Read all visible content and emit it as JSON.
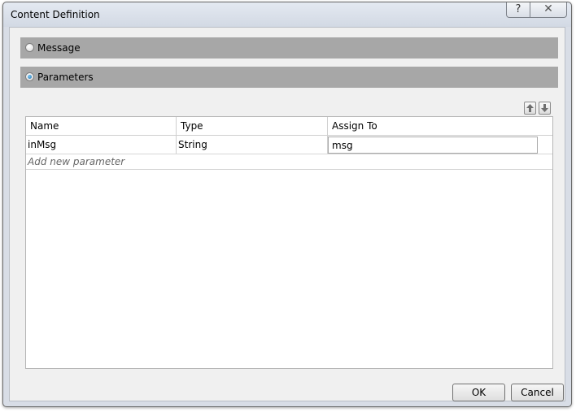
{
  "window": {
    "title": "Content Definition",
    "help_glyph": "?",
    "close_glyph": "✕"
  },
  "sections": {
    "message": {
      "label": "Message",
      "selected": false
    },
    "parameters": {
      "label": "Parameters",
      "selected": true
    }
  },
  "table": {
    "columns": [
      "Name",
      "Type",
      "Assign To"
    ],
    "rows": [
      {
        "name": "inMsg",
        "type": "String",
        "assign_to": "msg"
      }
    ],
    "add_new_label": "Add new parameter"
  },
  "icons": {
    "move_up": "arrow-up-icon",
    "move_down": "arrow-down-icon"
  },
  "buttons": {
    "ok": "OK",
    "cancel": "Cancel"
  },
  "colors": {
    "section_header": "#a7a7a7",
    "radio_selected": "#1b6fae"
  }
}
